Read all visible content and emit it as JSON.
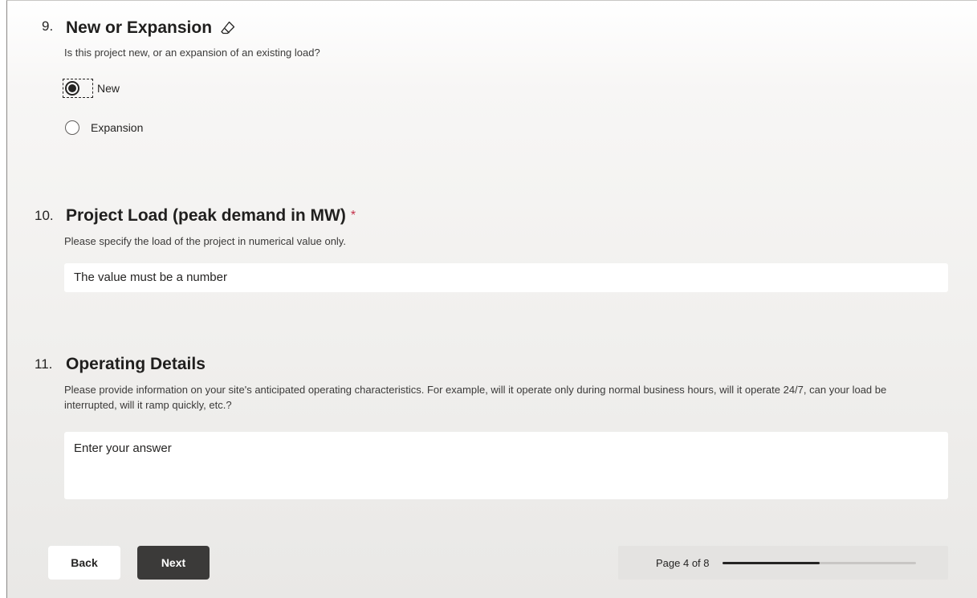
{
  "questions": [
    {
      "number": "9.",
      "title": "New or Expansion",
      "description": "Is this project new, or an expansion of an existing load?",
      "options": [
        "New",
        "Expansion"
      ],
      "selected": "New",
      "icon": "eraser-icon"
    },
    {
      "number": "10.",
      "title": "Project Load (peak demand in MW)",
      "required_mark": "*",
      "description": "Please specify the load of the project in numerical value only.",
      "input_placeholder": "The value must be a number"
    },
    {
      "number": "11.",
      "title": "Operating Details",
      "description": "Please provide information on your site's anticipated operating characteristics. For example, will it operate only during normal business hours, will it operate 24/7, can your load be interrupted, will it ramp quickly, etc.?",
      "input_placeholder": "Enter your answer"
    }
  ],
  "footer": {
    "back_label": "Back",
    "next_label": "Next",
    "page_text": "Page 4 of 8",
    "progress": 0.5
  }
}
